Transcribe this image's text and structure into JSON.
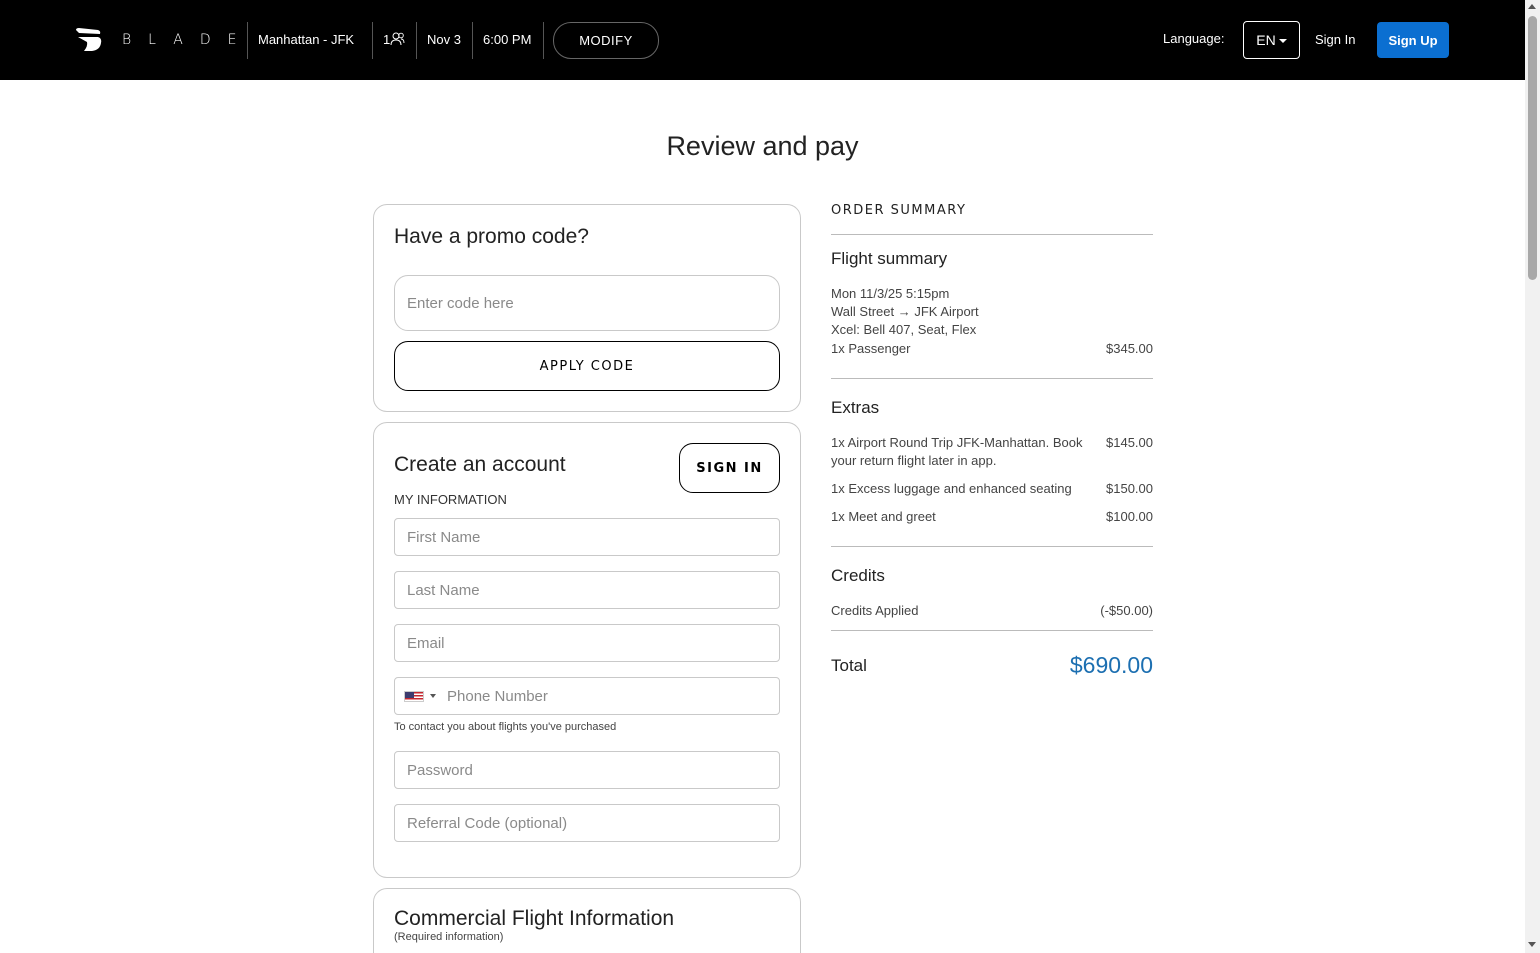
{
  "header": {
    "logo_text": "BLADE",
    "route": "Manhattan - JFK",
    "passengers": "1",
    "date": "Nov 3",
    "time": "6:00 PM",
    "modify_label": "MODIFY",
    "language_label": "Language:",
    "language_value": "EN",
    "sign_in_label": "Sign In",
    "sign_up_label": "Sign Up",
    "accent_color": "#0b6fd1"
  },
  "page": {
    "title": "Review and pay"
  },
  "promo": {
    "title": "Have a promo code?",
    "placeholder": "Enter code here",
    "apply_label": "APPLY CODE"
  },
  "account": {
    "title": "Create an account",
    "sign_in_label": "SIGN IN",
    "section_label": "MY INFORMATION",
    "first_name_placeholder": "First Name",
    "last_name_placeholder": "Last Name",
    "email_placeholder": "Email",
    "phone_placeholder": "Phone Number",
    "phone_country_icon": "us-flag-icon",
    "phone_hint": "To contact you about flights you've purchased",
    "password_placeholder": "Password",
    "referral_placeholder": "Referral Code (optional)"
  },
  "commercial": {
    "title": "Commercial Flight Information",
    "subtitle": "(Required information)"
  },
  "summary": {
    "heading": "ORDER SUMMARY",
    "flight": {
      "title": "Flight summary",
      "datetime": "Mon 11/3/25 5:15pm",
      "route": "Wall Street → JFK Airport",
      "aircraft": "Xcel: Bell 407, Seat, Flex",
      "passenger_label": "1x Passenger",
      "passenger_amount": "$345.00"
    },
    "extras": {
      "title": "Extras",
      "items": [
        {
          "label": "1x Airport Round Trip JFK-Manhattan. Book your return flight later in app.",
          "amount": "$145.00"
        },
        {
          "label": "1x Excess luggage and enhanced seating",
          "amount": "$150.00"
        },
        {
          "label": "1x Meet and greet",
          "amount": "$100.00"
        }
      ]
    },
    "credits": {
      "title": "Credits",
      "label": "Credits Applied",
      "amount": "(-$50.00)"
    },
    "total": {
      "label": "Total",
      "amount": "$690.00",
      "color": "#1c6fb1"
    }
  }
}
